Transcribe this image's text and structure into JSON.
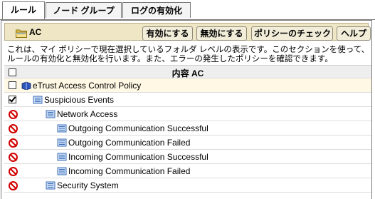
{
  "tabs": [
    {
      "label": "ルール",
      "active": true
    },
    {
      "label": "ノード グループ",
      "active": false
    },
    {
      "label": "ログの有効化",
      "active": false
    }
  ],
  "header": {
    "title": "AC",
    "icon": "folder-icon",
    "buttons": {
      "enable": "有効にする",
      "disable": "無効にする",
      "check": "ポリシーのチェック",
      "help": "ヘルプ"
    }
  },
  "description": "これは、マイ ポリシーで現在選択しているフォルダ レベルの表示です。このセクションを使って、ルールの有効化と無効化を行います。また、エラーの発生したポリシーを確認できます。",
  "table": {
    "column_header": "内容 AC",
    "rows": [
      {
        "label": "eTrust Access Control Policy",
        "state": "unchecked",
        "icon": "policy-book-icon",
        "indent": 0
      },
      {
        "label": "Suspicious Events",
        "state": "checked",
        "icon": "rule-list-icon",
        "indent": 1
      },
      {
        "label": "Network Access",
        "state": "error",
        "icon": "rule-list-icon",
        "indent": 2
      },
      {
        "label": "Outgoing Communication Successful",
        "state": "error",
        "icon": "rule-list-icon",
        "indent": 3
      },
      {
        "label": "Outgoing Communication Failed",
        "state": "error",
        "icon": "rule-list-icon",
        "indent": 3
      },
      {
        "label": "Incoming Communication Successful",
        "state": "error",
        "icon": "rule-list-icon",
        "indent": 3
      },
      {
        "label": "Incoming Communication Failed",
        "state": "error",
        "icon": "rule-list-icon",
        "indent": 3
      },
      {
        "label": "Security System",
        "state": "error",
        "icon": "rule-list-icon",
        "indent": 2
      }
    ]
  },
  "colors": {
    "header_bar": "#eee6c4",
    "error_red": "#d10000",
    "highlight_row": "#fff8e4"
  }
}
